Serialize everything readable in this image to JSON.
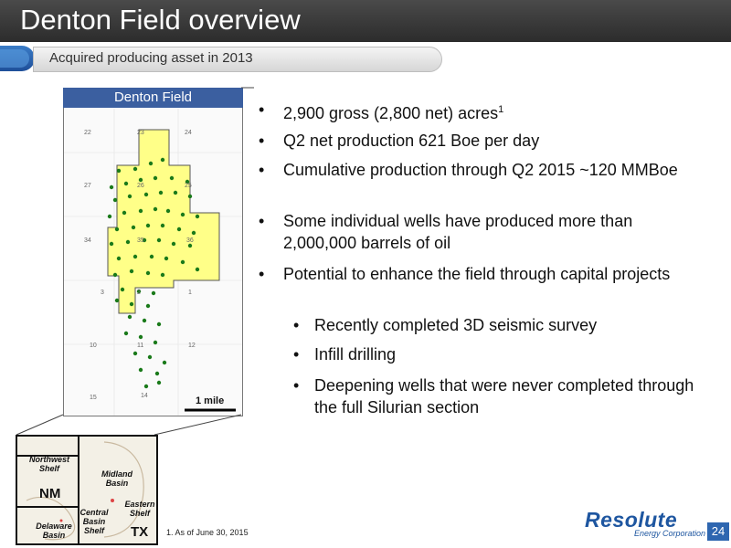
{
  "slide": {
    "title": "Denton Field overview",
    "subtitle": "Acquired producing asset in 2013",
    "page_number": "24",
    "footnote": "1.  As of June 30, 2015"
  },
  "map": {
    "header": "Denton Field",
    "scale_label": "1 mile",
    "section_labels": [
      "22",
      "23",
      "24",
      "27",
      "26",
      "25",
      "34",
      "35",
      "36",
      "3",
      "2",
      "1",
      "10",
      "11",
      "12",
      "15",
      "14"
    ]
  },
  "bullets": [
    {
      "text": "2,900 gross (2,800 net) acres",
      "sup": "1"
    },
    {
      "text": "Q2 net production 621 Boe per day"
    },
    {
      "text": "Cumulative production through Q2 2015 ~120 MMBoe"
    },
    {
      "text": "Some individual wells have produced more than 2,000,000 barrels of oil"
    },
    {
      "text": "Potential to enhance the field through capital projects"
    }
  ],
  "sub_bullets": [
    {
      "text": "Recently completed 3D seismic survey"
    },
    {
      "text": "Infill drilling"
    },
    {
      "text": "Deepening wells that were never completed through the full Silurian section"
    }
  ],
  "inset": {
    "northwest_shelf": "Northwest Shelf",
    "nm": "NM",
    "midland_basin": "Midland Basin",
    "eastern_shelf": "Eastern Shelf",
    "central_basin_shelf": "Central Basin Shelf",
    "delaware_basin": "Delaware Basin",
    "tx": "TX"
  },
  "logo": {
    "name": "Resolute",
    "tagline": "Energy Corporation"
  },
  "colors": {
    "title_bar": "#333333",
    "accent_blue": "#2e66b0",
    "field_fill": "#ffff88",
    "well": "#1a7a1a"
  }
}
